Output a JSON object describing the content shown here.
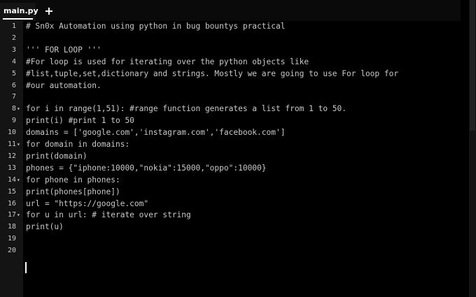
{
  "tab": {
    "label": "main.py",
    "add_label": "+"
  },
  "fold_marker": "▾",
  "lines": [
    {
      "n": "1",
      "fold": false,
      "text": "# Sn0x Automation using python in bug bountys practical"
    },
    {
      "n": "2",
      "fold": false,
      "text": ""
    },
    {
      "n": "3",
      "fold": false,
      "text": "''' FOR LOOP '''"
    },
    {
      "n": "4",
      "fold": false,
      "text": "#For loop is used for iterating over the python objects like"
    },
    {
      "n": "5",
      "fold": false,
      "text": "#list,tuple,set,dictionary and strings. Mostly we are going to use For loop for"
    },
    {
      "n": "6",
      "fold": false,
      "text": "#our automation."
    },
    {
      "n": "7",
      "fold": false,
      "text": ""
    },
    {
      "n": "8",
      "fold": true,
      "text": "for i in range(1,51): #range function generates a list from 1 to 50."
    },
    {
      "n": "9",
      "fold": false,
      "text": "print(i) #print 1 to 50"
    },
    {
      "n": "10",
      "fold": false,
      "text": "domains = ['google.com','instagram.com','facebook.com']"
    },
    {
      "n": "11",
      "fold": true,
      "text": "for domain in domains:"
    },
    {
      "n": "12",
      "fold": false,
      "text": "print(domain)"
    },
    {
      "n": "13",
      "fold": false,
      "text": "phones = {\"iphone:10000,\"nokia\":15000,\"oppo\":10000}"
    },
    {
      "n": "14",
      "fold": true,
      "text": "for phone in phones:"
    },
    {
      "n": "15",
      "fold": false,
      "text": "print(phones[phone])"
    },
    {
      "n": "16",
      "fold": false,
      "text": "url = \"https://google.com\""
    },
    {
      "n": "17",
      "fold": true,
      "text": "for u in url: # iterate over string"
    },
    {
      "n": "18",
      "fold": false,
      "text": "print(u)"
    },
    {
      "n": "19",
      "fold": false,
      "text": ""
    },
    {
      "n": "20",
      "fold": false,
      "text": ""
    }
  ]
}
